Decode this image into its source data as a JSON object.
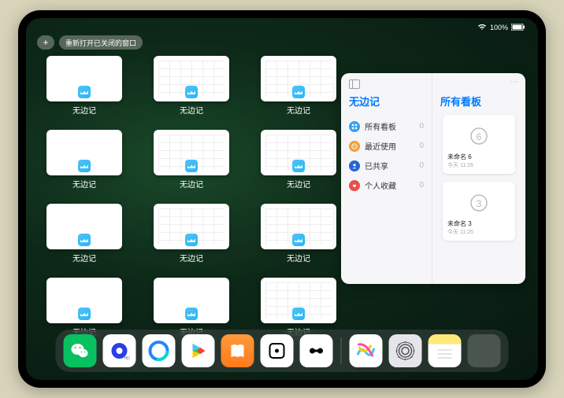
{
  "status": {
    "battery": "100%"
  },
  "top": {
    "plus": "+",
    "reopen": "重新打开已关闭的窗口"
  },
  "stage": {
    "app_label": "无边记",
    "windows": [
      {
        "variant": "blank"
      },
      {
        "variant": "grid"
      },
      {
        "variant": "grid"
      },
      {
        "variant": "blank"
      },
      {
        "variant": "grid"
      },
      {
        "variant": "grid"
      },
      {
        "variant": "blank"
      },
      {
        "variant": "grid"
      },
      {
        "variant": "grid"
      },
      {
        "variant": "blank"
      },
      {
        "variant": "blank"
      },
      {
        "variant": "grid"
      }
    ]
  },
  "panel": {
    "menu": "⋯",
    "left_title": "无边记",
    "right_title": "所有看板",
    "categories": [
      {
        "label": "所有看板",
        "count": "0",
        "color": "blue",
        "icon": "grid"
      },
      {
        "label": "最近使用",
        "count": "0",
        "color": "orange",
        "icon": "clock"
      },
      {
        "label": "已共享",
        "count": "0",
        "color": "dblue",
        "icon": "person"
      },
      {
        "label": "个人收藏",
        "count": "0",
        "color": "red",
        "icon": "heart"
      }
    ],
    "boards": [
      {
        "name": "未命名 6",
        "meta": "今天 11:26",
        "glyph": "6"
      },
      {
        "name": "未命名 3",
        "meta": "今天 11:25",
        "glyph": "3"
      }
    ]
  },
  "dock": {
    "items": [
      {
        "name": "wechat-icon"
      },
      {
        "name": "quark-icon"
      },
      {
        "name": "qqbrowser-icon"
      },
      {
        "name": "play-icon"
      },
      {
        "name": "books-icon"
      },
      {
        "name": "dice-icon"
      },
      {
        "name": "connect-icon"
      }
    ],
    "right": [
      {
        "name": "freeform-icon"
      },
      {
        "name": "settings-icon"
      },
      {
        "name": "notes-icon"
      },
      {
        "name": "app-library-icon"
      }
    ]
  }
}
